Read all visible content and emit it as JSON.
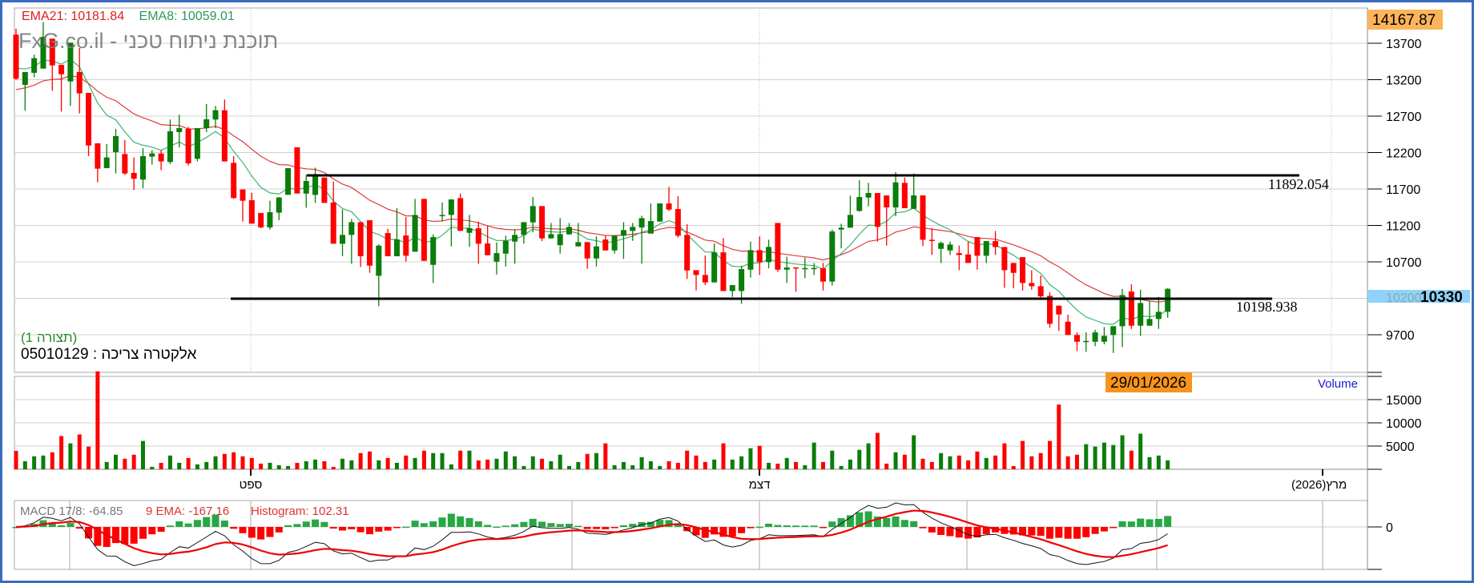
{
  "header": {
    "ema21_label": "EMA21: 10181.84",
    "ema8_label": "EMA8: 10059.01",
    "watermark": "FxG.co.il - תוכנת ניתוח טכני",
    "layout_label": "(תצורה 1)",
    "instrument": "אלקטרה צריכה : 05010129"
  },
  "colors": {
    "up": "#0a7d0a",
    "down": "#ff0000",
    "ema21": "#e03a3a",
    "ema8": "#3cb371",
    "frame": "#3a6cc0",
    "highlight_orange": "#f7941d",
    "last_price_bg": "#8fd3fb"
  },
  "price_axis": {
    "top_value": "14167.87",
    "ticks": [
      "13700",
      "13200",
      "12700",
      "12200",
      "11700",
      "11200",
      "10700",
      "10200",
      "9700"
    ],
    "last_price": "10330",
    "hidden_tick": "10200"
  },
  "lines": {
    "resistance": {
      "value": 11892.054,
      "label": "11892.054"
    },
    "support": {
      "value": 10198.938,
      "label": "10198.938"
    }
  },
  "cursor_date": "29/01/2026",
  "volume_panel": {
    "label": "Volume",
    "ticks": [
      "15000",
      "10000",
      "5000"
    ]
  },
  "date_axis": {
    "labels": [
      "ספט",
      "דצמ",
      "מרץ(2026)"
    ]
  },
  "macd_panel": {
    "macd_label": "MACD 17/8:  -64.85",
    "signal_label": "9 EMA:  -167.16",
    "histogram_label": "Histogram:  102.31",
    "zero_tick": "0"
  },
  "chart_data": {
    "type": "candlestick",
    "ylim": [
      9200,
      14167.87
    ],
    "ema21_seed": 13050,
    "ema8_seed": 13400,
    "ohlc": [
      [
        13818,
        13900,
        13200,
        13213
      ],
      [
        13129,
        13305,
        12774,
        13305
      ],
      [
        13294,
        13543,
        13231,
        13495
      ],
      [
        13352,
        13990,
        13352,
        13788
      ],
      [
        13763,
        13763,
        13048,
        13396
      ],
      [
        13404,
        13404,
        12763,
        13275
      ],
      [
        13176,
        13708,
        12840,
        13708
      ],
      [
        13305,
        13634,
        12737,
        13012
      ],
      [
        13019,
        13019,
        12151,
        12297
      ],
      [
        12327,
        12327,
        11792,
        11979
      ],
      [
        11986,
        12316,
        11986,
        12133
      ],
      [
        12206,
        12524,
        11913,
        12426
      ],
      [
        12180,
        12371,
        11894,
        11913
      ],
      [
        11920,
        12133,
        11686,
        11840
      ],
      [
        11829,
        12261,
        11711,
        12151
      ],
      [
        12144,
        12235,
        12034,
        12187
      ],
      [
        12187,
        12231,
        11957,
        12078
      ],
      [
        12070,
        12653,
        12041,
        12492
      ],
      [
        12481,
        12719,
        12272,
        12535
      ],
      [
        12524,
        12554,
        12023,
        12052
      ],
      [
        12114,
        12535,
        12078,
        12535
      ],
      [
        12535,
        12865,
        12481,
        12656
      ],
      [
        12653,
        12840,
        12535,
        12781
      ],
      [
        12781,
        12927,
        12078,
        12078
      ],
      [
        12059,
        12151,
        11565,
        11576
      ],
      [
        11693,
        11693,
        11253,
        11539
      ],
      [
        11546,
        11649,
        11224,
        11224
      ],
      [
        11371,
        11371,
        11162,
        11173
      ],
      [
        11173,
        11539,
        11143,
        11382
      ],
      [
        11375,
        11590,
        11272,
        11583
      ],
      [
        11620,
        11986,
        11620,
        11986
      ],
      [
        12272,
        12272,
        11638,
        11638
      ],
      [
        11637,
        11894,
        11443,
        11810
      ],
      [
        11619,
        11993,
        11509,
        11875
      ],
      [
        11857,
        11857,
        11509,
        11509
      ],
      [
        11516,
        11802,
        10949,
        10949
      ],
      [
        10949,
        11418,
        10777,
        11070
      ],
      [
        11070,
        11289,
        10674,
        11245
      ],
      [
        11245,
        11245,
        10630,
        10777
      ],
      [
        11271,
        11271,
        10550,
        10648
      ],
      [
        10509,
        10941,
        10092,
        10923
      ],
      [
        11095,
        11154,
        10777,
        10777
      ],
      [
        10777,
        11436,
        10777,
        11007
      ],
      [
        11062,
        11315,
        10703,
        10784
      ],
      [
        10839,
        11564,
        10839,
        11344
      ],
      [
        11564,
        11564,
        10714,
        10714
      ],
      [
        10659,
        11077,
        10410,
        11040
      ],
      [
        11340,
        11516,
        11253,
        11344
      ],
      [
        11344,
        11557,
        10912,
        11557
      ],
      [
        11575,
        11637,
        11125,
        11125
      ],
      [
        11099,
        11344,
        10905,
        11161
      ],
      [
        11161,
        11253,
        10674,
        10949
      ],
      [
        10953,
        11190,
        10791,
        10791
      ],
      [
        10703,
        10967,
        10527,
        10820
      ],
      [
        10813,
        11059,
        10637,
        10989
      ],
      [
        10978,
        11150,
        10674,
        11070
      ],
      [
        11070,
        11245,
        10949,
        11245
      ],
      [
        11242,
        11590,
        11106,
        11465
      ],
      [
        11465,
        11465,
        10985,
        11022
      ],
      [
        11022,
        11234,
        11022,
        11081
      ],
      [
        10930,
        11300,
        10813,
        11081
      ],
      [
        11077,
        11234,
        11077,
        11180
      ],
      [
        10912,
        11234,
        10912,
        10971
      ],
      [
        10971,
        10971,
        10605,
        10747
      ],
      [
        10747,
        11051,
        10637,
        10912
      ],
      [
        11007,
        11059,
        10857,
        10857
      ],
      [
        10857,
        11059,
        10813,
        11059
      ],
      [
        11059,
        11245,
        10740,
        11136
      ],
      [
        11125,
        11234,
        10989,
        11180
      ],
      [
        11172,
        11333,
        10674,
        11300
      ],
      [
        11088,
        11502,
        11088,
        11260
      ],
      [
        11253,
        11502,
        11253,
        11502
      ],
      [
        11502,
        11729,
        11399,
        11418
      ],
      [
        11425,
        11601,
        11033,
        11059
      ],
      [
        11070,
        11216,
        10465,
        10582
      ],
      [
        10586,
        10586,
        10308,
        10520
      ],
      [
        10520,
        10787,
        10381,
        10418
      ],
      [
        10418,
        10952,
        10418,
        10831
      ],
      [
        10831,
        11026,
        10300,
        10300
      ],
      [
        10300,
        10381,
        10220,
        10381
      ],
      [
        10300,
        10648,
        10125,
        10601
      ],
      [
        10593,
        10978,
        10484,
        10861
      ],
      [
        10861,
        11051,
        10520,
        10696
      ],
      [
        10696,
        11004,
        10612,
        10905
      ],
      [
        11234,
        11234,
        10564,
        10593
      ],
      [
        10593,
        10769,
        10410,
        10623
      ],
      [
        10625,
        10625,
        10289,
        10619
      ],
      [
        10612,
        10758,
        10476,
        10615
      ],
      [
        10612,
        10685,
        10520,
        10616
      ],
      [
        10612,
        10685,
        10308,
        10429
      ],
      [
        10429,
        11143,
        10374,
        11117
      ],
      [
        11143,
        11223,
        10886,
        11169
      ],
      [
        11169,
        11608,
        11169,
        11344
      ],
      [
        11399,
        11820,
        11388,
        11590
      ],
      [
        11582,
        11784,
        11462,
        11645
      ],
      [
        11645,
        11645,
        10978,
        11180
      ],
      [
        11612,
        11612,
        10923,
        11447
      ],
      [
        11447,
        11930,
        11326,
        11791
      ],
      [
        11784,
        11857,
        11436,
        11436
      ],
      [
        11428,
        11912,
        11428,
        11612
      ],
      [
        11612,
        11612,
        10916,
        11003
      ],
      [
        11003,
        11161,
        10795,
        10997
      ],
      [
        10879,
        10978,
        10685,
        10960
      ],
      [
        10857,
        10978,
        10795,
        10938
      ],
      [
        10820,
        10923,
        10586,
        10795
      ],
      [
        10802,
        10978,
        10685,
        10685
      ],
      [
        11040,
        11040,
        10593,
        10784
      ],
      [
        10784,
        10985,
        10685,
        10985
      ],
      [
        10985,
        11124,
        10795,
        10904
      ],
      [
        10904,
        10904,
        10344,
        10586
      ],
      [
        10685,
        10685,
        10337,
        10549
      ],
      [
        10765,
        10765,
        10307,
        10410
      ],
      [
        10410,
        10586,
        10318,
        10366
      ],
      [
        10366,
        10512,
        10209,
        10227
      ],
      [
        10234,
        10282,
        9795,
        9850
      ],
      [
        10099,
        10099,
        9751,
        9978
      ],
      [
        9879,
        9978,
        9696,
        9696
      ],
      [
        9696,
        9732,
        9476,
        9604
      ],
      [
        9611,
        9732,
        9465,
        9615
      ],
      [
        9604,
        9769,
        9542,
        9732
      ],
      [
        9604,
        9806,
        9568,
        9685
      ],
      [
        9696,
        9817,
        9450,
        9817
      ],
      [
        9817,
        10329,
        9531,
        10245
      ],
      [
        10293,
        10392,
        9780,
        9824
      ],
      [
        9824,
        10318,
        9685,
        10135
      ],
      [
        9824,
        10161,
        9824,
        9916
      ],
      [
        9916,
        10220,
        9780,
        10015
      ],
      [
        10015,
        10340,
        9934,
        10330
      ]
    ],
    "volume": [
      3950,
      1740,
      2790,
      2960,
      3660,
      7150,
      5580,
      7500,
      4880,
      21090,
      1570,
      3140,
      2270,
      3140,
      6100,
      520,
      1390,
      2960,
      1390,
      2440,
      1050,
      1570,
      2790,
      3310,
      3660,
      2790,
      2440,
      1220,
      1390,
      870,
      700,
      1390,
      1740,
      2090,
      1740,
      520,
      2270,
      1920,
      3490,
      3830,
      1920,
      2440,
      1390,
      2960,
      2440,
      4010,
      3490,
      3490,
      1050,
      4010,
      4010,
      1920,
      2090,
      2270,
      3830,
      2790,
      700,
      2790,
      2270,
      1740,
      3140,
      700,
      1570,
      3310,
      3490,
      5580,
      870,
      1570,
      870,
      2610,
      1740,
      700,
      1740,
      1390,
      4010,
      2960,
      1570,
      2090,
      5580,
      2090,
      2790,
      4530,
      5050,
      1390,
      1220,
      2440,
      1570,
      870,
      5750,
      1570,
      4010,
      700,
      2090,
      4180,
      5580,
      7840,
      1220,
      3660,
      3140,
      7320,
      2270,
      1570,
      3490,
      2790,
      2960,
      1920,
      3830,
      2440,
      2960,
      5580,
      700,
      6100,
      2790,
      3490,
      6100,
      13940,
      2790,
      3140,
      5400,
      4880,
      5750,
      5230,
      7320,
      4010,
      7670,
      2610,
      2960,
      1920
    ],
    "macd": {
      "fast": 8,
      "slow": 17,
      "signal": 9
    }
  }
}
